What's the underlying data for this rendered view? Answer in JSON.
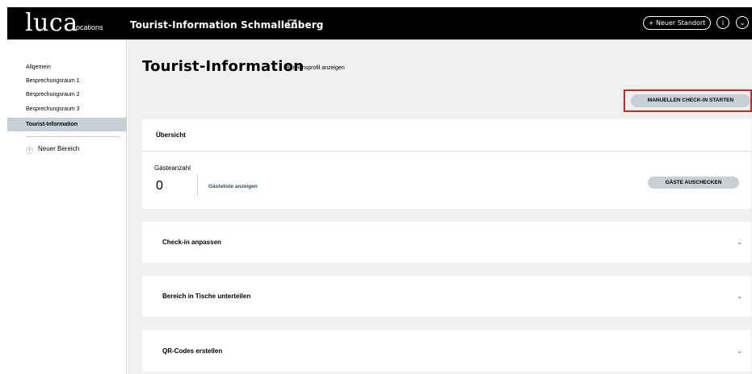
{
  "header": {
    "logo": "luca",
    "logo_sub": "Locations",
    "group_name": "Tourist-Information Schmallenberg",
    "edit_icon": "edit-icon",
    "new_location_label": "+ Neuer Standort",
    "info_icon": "i",
    "menu_icon": "⌄"
  },
  "sidebar": {
    "items": [
      {
        "label": "Allgemein"
      },
      {
        "label": "Besprechungsraum 1"
      },
      {
        "label": "Besprechungsraum 2"
      },
      {
        "label": "Besprechungsraum 3"
      },
      {
        "label": "Tourist-Information"
      }
    ],
    "new_area_label": "Neuer Bereich",
    "new_area_icon": "+"
  },
  "main": {
    "title": "Tourist-Information",
    "subtitle": "Bereichsprofil anzeigen",
    "manual_checkin_label": "MANUELLEN CHECK-IN STARTEN",
    "overview": {
      "title": "Übersicht",
      "guests_label": "Gästeanzahl",
      "guests_count": "0",
      "guest_list_link": "Gästeliste anzeigen",
      "checkout_label": "GÄSTE AUSCHECKEN"
    },
    "accordions": [
      {
        "title": "Check-in anpassen"
      },
      {
        "title": "Bereich in Tische unterteilen"
      },
      {
        "title": "QR-Codes erstellen"
      }
    ],
    "chevron": "⌄"
  },
  "colors": {
    "header_bg": "#000000",
    "main_bg": "#eef0f0",
    "button_bg": "#c7d0d7",
    "highlight": "#c62828"
  }
}
